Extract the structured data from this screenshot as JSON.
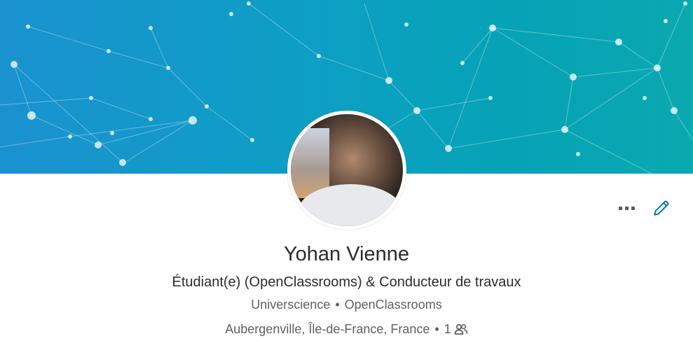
{
  "profile": {
    "name": "Yohan Vienne",
    "headline": "Étudiant(e) (OpenClassrooms) & Conducteur de travaux",
    "school": "Universcience",
    "company": "OpenClassrooms",
    "separator": "•",
    "location": "Aubergenville, Île-de-France, France",
    "connections": "1"
  },
  "icons": {
    "more": "ellipsis-icon",
    "edit": "pencil-icon",
    "connections": "people-icon"
  },
  "colors": {
    "banner_start": "#1a92d0",
    "banner_end": "#0aa9b0",
    "accent": "#0073b1",
    "text_primary": "#2b2b2b",
    "text_secondary": "#5f5f5f"
  }
}
